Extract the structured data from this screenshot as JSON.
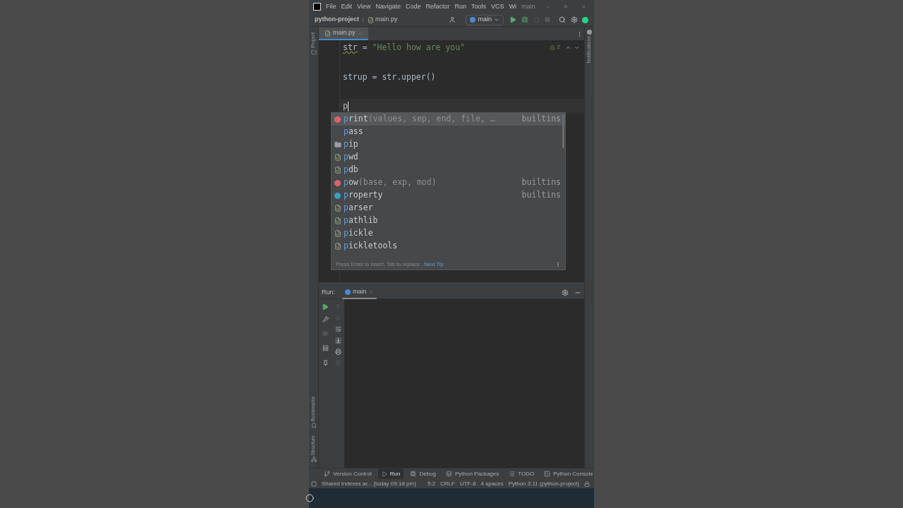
{
  "menu_bar": {
    "items": [
      "File",
      "Edit",
      "View",
      "Navigate",
      "Code",
      "Refactor",
      "Run",
      "Tools",
      "VCS",
      "Wi"
    ],
    "title": "main."
  },
  "breadcrumbs": [
    "python-project",
    "main.py"
  ],
  "run_config": "main",
  "side_strips": {
    "left_top": "Project",
    "left_bottom": [
      "Bookmarks",
      "Structure"
    ],
    "right": "Notifications"
  },
  "editor_tabs": [
    {
      "label": "main.py",
      "selected": true
    }
  ],
  "editor": {
    "warning_count": "2",
    "lines": [
      {
        "current": false,
        "segments": [
          {
            "kind": "warned",
            "text": "str"
          },
          {
            "kind": "plain",
            "text": " = "
          },
          {
            "kind": "string",
            "text": "\"Hello how are you\""
          }
        ]
      },
      {
        "current": false
      },
      {
        "current": false,
        "segments": [
          {
            "kind": "plain",
            "text": "strup = str.upper()"
          }
        ]
      },
      {
        "current": false
      },
      {
        "current": true,
        "segments": [
          {
            "kind": "plain",
            "text": "p"
          }
        ]
      }
    ]
  },
  "completion": {
    "items": [
      {
        "kind": "function",
        "match": "p",
        "name": "rint",
        "detail": "(values, sep, end, file, …",
        "source": "builtins",
        "selected": true
      },
      {
        "kind": "keyword",
        "match": "p",
        "name": "ass",
        "selected": false
      },
      {
        "kind": "folder",
        "match": "p",
        "name": "ip",
        "selected": false
      },
      {
        "kind": "module",
        "match": "p",
        "name": "wd",
        "selected": false
      },
      {
        "kind": "module",
        "match": "p",
        "name": "db",
        "selected": false
      },
      {
        "kind": "function",
        "match": "p",
        "name": "ow",
        "detail": "(base, exp, mod)",
        "source": "builtins",
        "selected": false
      },
      {
        "kind": "class",
        "match": "p",
        "name": "roperty",
        "source": "builtins",
        "selected": false
      },
      {
        "kind": "module",
        "match": "p",
        "name": "arser",
        "selected": false
      },
      {
        "kind": "module",
        "match": "p",
        "name": "athlib",
        "selected": false
      },
      {
        "kind": "module",
        "match": "p",
        "name": "ickle",
        "selected": false
      },
      {
        "kind": "module",
        "match": "p",
        "name": "ickletools",
        "selected": false
      }
    ],
    "footer": "Press Enter to insert, Tab to replace",
    "tip_link": "Next Tip"
  },
  "run_panel": {
    "label": "Run:",
    "tabs": [
      {
        "label": "main",
        "selected": true
      }
    ]
  },
  "tool_windows": [
    {
      "kind": "vcs",
      "label": "Version Control",
      "selected": false
    },
    {
      "kind": "run",
      "label": "Run",
      "selected": true
    },
    {
      "kind": "debug",
      "label": "Debug",
      "selected": false
    },
    {
      "kind": "packages",
      "label": "Python Packages",
      "selected": false
    },
    {
      "kind": "todo",
      "label": "TODO",
      "selected": false
    },
    {
      "kind": "console",
      "label": "Python Console",
      "selected": false
    }
  ],
  "status_bar": {
    "message": "Shared indexes ar... (today 09:18 pm)",
    "items": [
      "5:2",
      "CRLF",
      "UTF-8",
      "4 spaces",
      "Python 3.11 (python-project)"
    ]
  }
}
